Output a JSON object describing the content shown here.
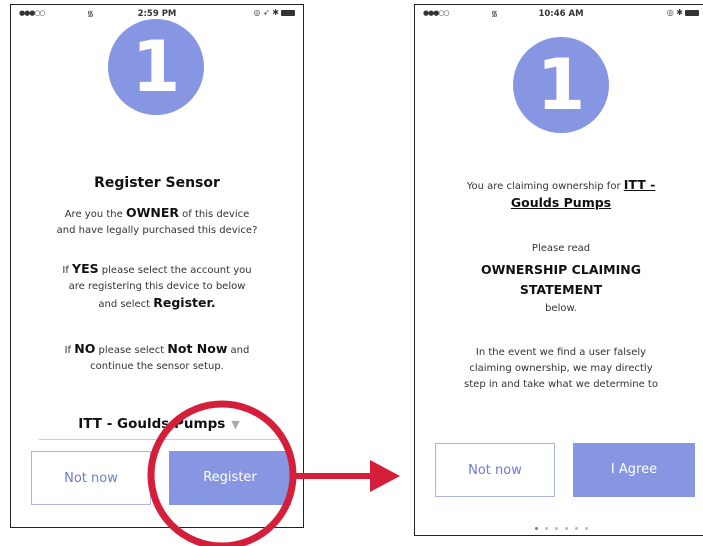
{
  "screens": [
    {
      "status": {
        "time": "2:59 PM"
      },
      "badge": "1",
      "title": "Register Sensor",
      "q_pre": "Are you the ",
      "q_bold": "OWNER",
      "q_post": " of this device",
      "q_line2": "and have legally purchased this device?",
      "yes_pre": "If ",
      "yes_bold": "YES",
      "yes_post": " please select the account you",
      "yes_line2": "are registering this device to below",
      "yes_line3_pre": "and select ",
      "yes_line3_bold": "Register.",
      "no_pre": "If ",
      "no_bold": "NO",
      "no_mid": " please select ",
      "no_bold2": "Not Now",
      "no_post": " and",
      "no_line2": "continue the sensor setup.",
      "account": "ITT - Goulds Pumps",
      "left_button": "Not now",
      "right_button": "Register",
      "page_count": 6,
      "active_page": 0
    },
    {
      "status": {
        "time": "10:46 AM"
      },
      "badge": "1",
      "claim_pre": "You are claiming ownership for ",
      "claim_bold1": "ITT -",
      "claim_bold2": "Goulds Pumps",
      "read": "Please read",
      "statement_line1": "OWNERSHIP CLAIMING",
      "statement_line2": "STATEMENT",
      "below": "below.",
      "body_line1": "In the event we find a user falsely",
      "body_line2": "claiming ownership, we may directly",
      "body_line3": "step in and take what we determine to",
      "left_button": "Not now",
      "right_button": "I Agree",
      "page_count": 6,
      "active_page": 0
    }
  ],
  "colors": {
    "accent": "#8796e2",
    "highlight": "#d51f3a"
  }
}
